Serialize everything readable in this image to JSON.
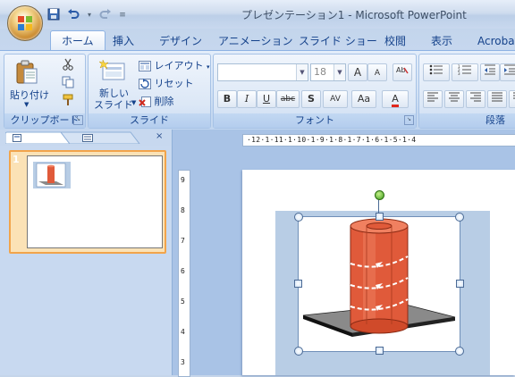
{
  "title": "プレゼンテーション1 - Microsoft PowerPoint",
  "quick_access": {
    "save_icon": "save-icon",
    "undo_icon": "undo-icon",
    "redo_icon": "redo-icon",
    "customize_icon": "customize-qat-icon"
  },
  "tabs": [
    {
      "label": "ホーム"
    },
    {
      "label": "挿入"
    },
    {
      "label": "デザイン"
    },
    {
      "label": "アニメーション"
    },
    {
      "label": "スライド ショー"
    },
    {
      "label": "校閲"
    },
    {
      "label": "表示"
    },
    {
      "label": "Acrobat"
    }
  ],
  "ribbon": {
    "clipboard": {
      "label": "クリップボード",
      "paste": "貼り付け",
      "paste_arrow": "▼"
    },
    "slides": {
      "label": "スライド",
      "new_slide_line1": "新しい",
      "new_slide_line2": "スライド",
      "layout": "レイアウト",
      "reset": "リセット",
      "delete": "削除"
    },
    "font": {
      "label": "フォント",
      "font_name": "",
      "font_size": "18",
      "bold": "B",
      "italic": "I",
      "underline": "U",
      "strikethrough": "abc",
      "shadow": "S",
      "spacing": "AV",
      "case": "Aa",
      "color": "A",
      "grow": "A",
      "shrink": "A"
    },
    "paragraph": {
      "label": "段落"
    }
  },
  "ruler": {
    "horizontal": "·12·1·11·1·10·1·9·1·8·1·7·1·6·1·5·1·4",
    "vertical": [
      "9",
      "8",
      "7",
      "6",
      "5",
      "4",
      "3"
    ]
  },
  "slide_panel": {
    "thumb_number": "1"
  },
  "colors": {
    "ribbon_text": "#15428b",
    "cylinder": "#e05a3a",
    "base_plate": "#8a8a8a",
    "selection_frame": "#6f8fb8",
    "rotation_handle": "#3d9a1b",
    "thumb_highlight": "#f2a44b"
  }
}
